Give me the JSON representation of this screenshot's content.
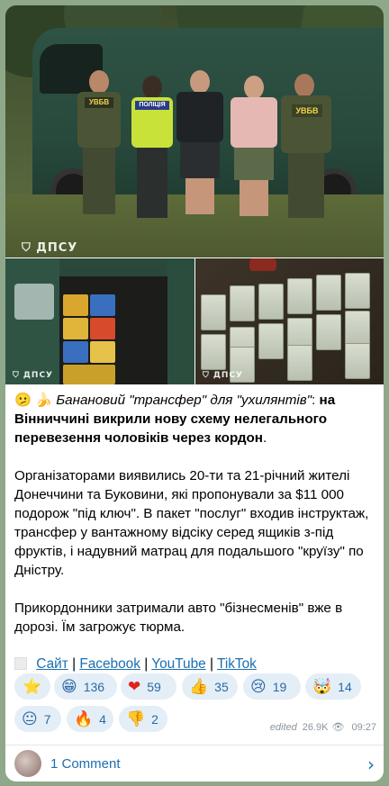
{
  "photos": {
    "main_watermark": "ДПСУ",
    "left_watermark": "ДПСУ",
    "right_watermark": "ДПСУ",
    "vest_labels": [
      "УВБВ",
      "ПОЛІЦІЯ",
      "УВБВ"
    ]
  },
  "post": {
    "title_emoji": "🫤 🍌",
    "title_italic": "Банановий \"трансфер\" для \"ухилянтів\"",
    "title_colon": ":",
    "title_bold": "на Вінниччині викрили нову схему нелегального перевезення чоловіків через кордон",
    "title_end": ".",
    "para1": "Організаторами виявились 20-ти та 21-річний жителі Донеччини та Буковини, які пропонували за $11 000 подорож \"під ключ\". В пакет \"послуг\" входив інструктаж, трансфер у вантажному відсіку серед ящиків з-під фруктів, і надувний матрац для подальшого \"круїзу\" по Дністру.",
    "para2": "Прикордонники затримали авто \"бізнесменів\" вже в дорозі. Їм загрожує тюрма."
  },
  "links": {
    "site": "Сайт",
    "facebook": "Facebook",
    "youtube": "YouTube",
    "tiktok": "TikTok",
    "sep": "|"
  },
  "reactions": [
    {
      "emoji": "⭐",
      "count": ""
    },
    {
      "emoji": "😁",
      "count": "136"
    },
    {
      "emoji": "❤",
      "count": "59"
    },
    {
      "emoji": "👍",
      "count": "35"
    },
    {
      "emoji": "😢",
      "count": "19"
    },
    {
      "emoji": "🤯",
      "count": "14"
    },
    {
      "emoji": "😐",
      "count": "7"
    },
    {
      "emoji": "🔥",
      "count": "4"
    },
    {
      "emoji": "👎",
      "count": "2"
    }
  ],
  "meta": {
    "edited": "edited",
    "views": "26.9K",
    "view_icon": "👁",
    "time": "09:27"
  },
  "comments": {
    "label": "1 Comment",
    "chevron": "›"
  }
}
